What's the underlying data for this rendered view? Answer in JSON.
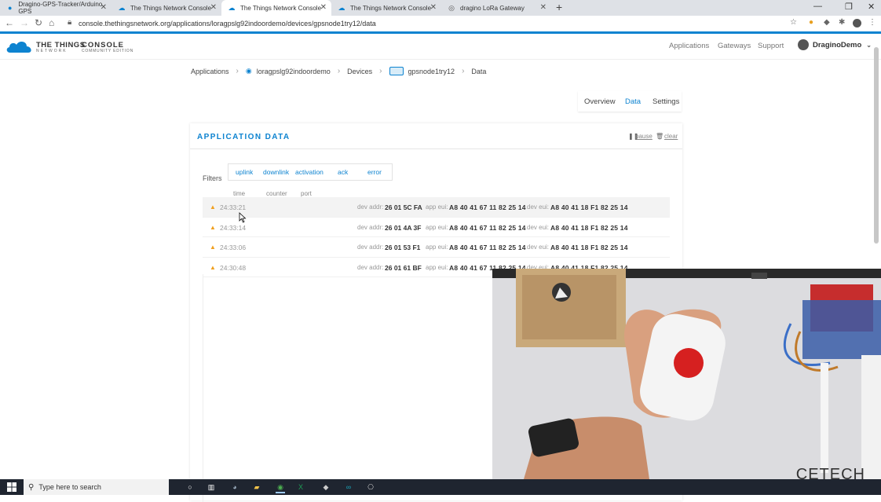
{
  "browser": {
    "tabs": [
      {
        "title": "Dragino-GPS-Tracker/Arduino GPS",
        "icon": "github-icon",
        "active": false
      },
      {
        "title": "The Things Network Console",
        "icon": "ttn-icon",
        "active": false
      },
      {
        "title": "The Things Network Console",
        "icon": "ttn-icon",
        "active": true
      },
      {
        "title": "The Things Network Console",
        "icon": "ttn-icon",
        "active": false
      },
      {
        "title": "dragino LoRa Gateway",
        "icon": "globe-icon",
        "active": false
      }
    ],
    "url": "console.thethingsnetwork.org/applications/loragpslg92indoordemo/devices/gpsnode1try12/data"
  },
  "header": {
    "brand": "THE THINGS",
    "brand_sub": "NETWORK",
    "console": "CONSOLE",
    "console_sub": "COMMUNITY EDITION",
    "nav": [
      "Applications",
      "Gateways",
      "Support"
    ],
    "user": "DraginoDemo"
  },
  "breadcrumb": [
    "Applications",
    "loragpslg92indoordemo",
    "Devices",
    "gpsnode1try12",
    "Data"
  ],
  "page_tabs": [
    "Overview",
    "Data",
    "Settings"
  ],
  "panel": {
    "title": "APPLICATION DATA",
    "pause": "pause",
    "clear": "clear",
    "filters_label": "Filters",
    "filters": [
      "uplink",
      "downlink",
      "activation",
      "ack",
      "error"
    ],
    "columns": [
      "time",
      "counter",
      "port"
    ],
    "label_devaddr": "dev addr:",
    "label_appeui": "app eui:",
    "label_deveui": "dev eui:",
    "rows": [
      {
        "time": "24:33:21",
        "dev_addr": "26 01 5C FA",
        "app_eui": "A8 40 41 67 11 82 25 14",
        "dev_eui": "A8 40 41 18 F1 82 25 14"
      },
      {
        "time": "24:33:14",
        "dev_addr": "26 01 4A 3F",
        "app_eui": "A8 40 41 67 11 82 25 14",
        "dev_eui": "A8 40 41 18 F1 82 25 14"
      },
      {
        "time": "24:33:06",
        "dev_addr": "26 01 53 F1",
        "app_eui": "A8 40 41 67 11 82 25 14",
        "dev_eui": "A8 40 41 18 F1 82 25 14"
      },
      {
        "time": "24:30:48",
        "dev_addr": "26 01 61 BF",
        "app_eui": "A8 40 41 67 11 82 25 14",
        "dev_eui": "A8 40 41 18 F1 82 25 14"
      }
    ]
  },
  "video": {
    "watermark": "CETECH"
  },
  "taskbar": {
    "search_placeholder": "Type here to search"
  },
  "colors": {
    "accent": "#0d83d0",
    "uplink_arrow": "#f0a020"
  }
}
